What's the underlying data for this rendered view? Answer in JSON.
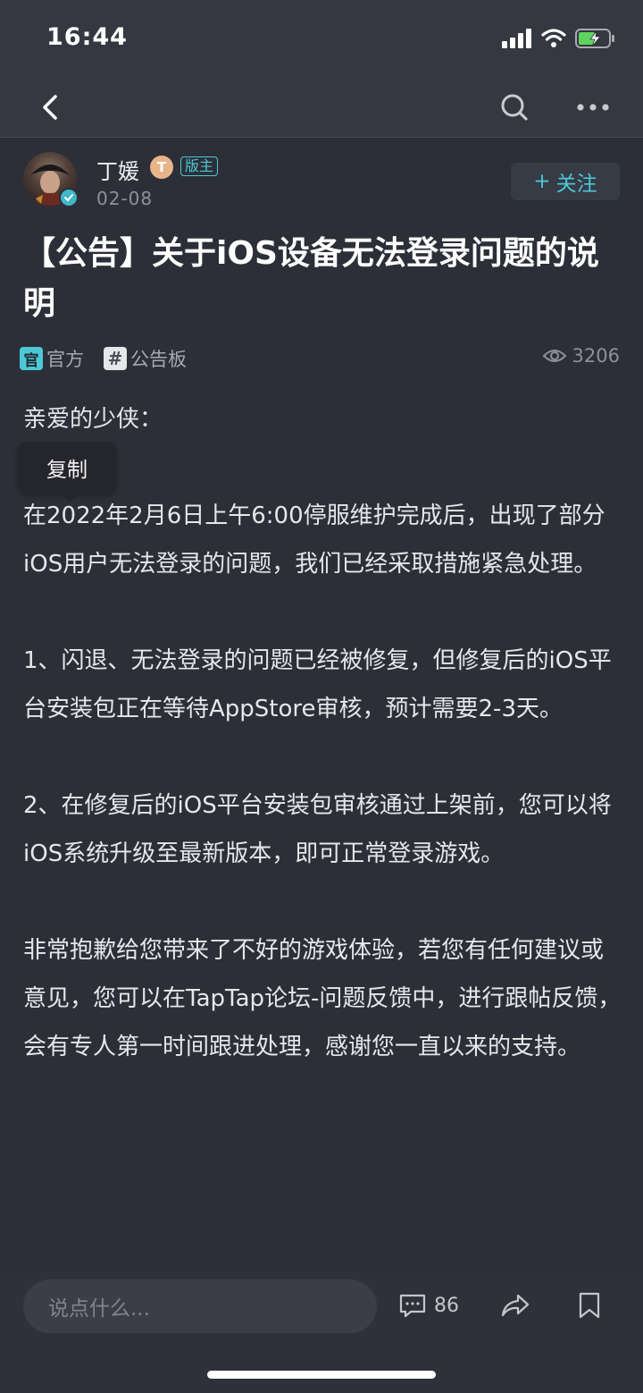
{
  "status_bar": {
    "time": "16:44"
  },
  "author": {
    "name": "丁媛",
    "level_letter": "T",
    "badge": "版主",
    "date": "02-08"
  },
  "follow": {
    "plus": "+",
    "label": "关注"
  },
  "post": {
    "title": "【公告】关于iOS设备无法登录问题的说明",
    "tags": [
      {
        "icon": "官",
        "label": "官方"
      },
      {
        "icon": "#",
        "label": "公告板"
      }
    ],
    "views": "3206",
    "greeting": "亲爱的少侠：",
    "paragraphs": [
      "在2022年2月6日上午6:00停服维护完成后，出现了部分iOS用户无法登录的问题，我们已经采取措施紧急处理。",
      "1、闪退、无法登录的问题已经被修复，但修复后的iOS平台安装包正在等待AppStore审核，预计需要2-3天。",
      "2、在修复后的iOS平台安装包审核通过上架前，您可以将iOS系统升级至最新版本，即可正常登录游戏。",
      "非常抱歉给您带来了不好的游戏体验，若您有任何建议或意见，您可以在TapTap论坛-问题反馈中，进行跟帖反馈，会有专人第一时间跟进处理，感谢您一直以来的支持。"
    ]
  },
  "tooltip": {
    "copy_label": "复制"
  },
  "bottom_bar": {
    "input_placeholder": "说点什么...",
    "comment_count": "86"
  }
}
